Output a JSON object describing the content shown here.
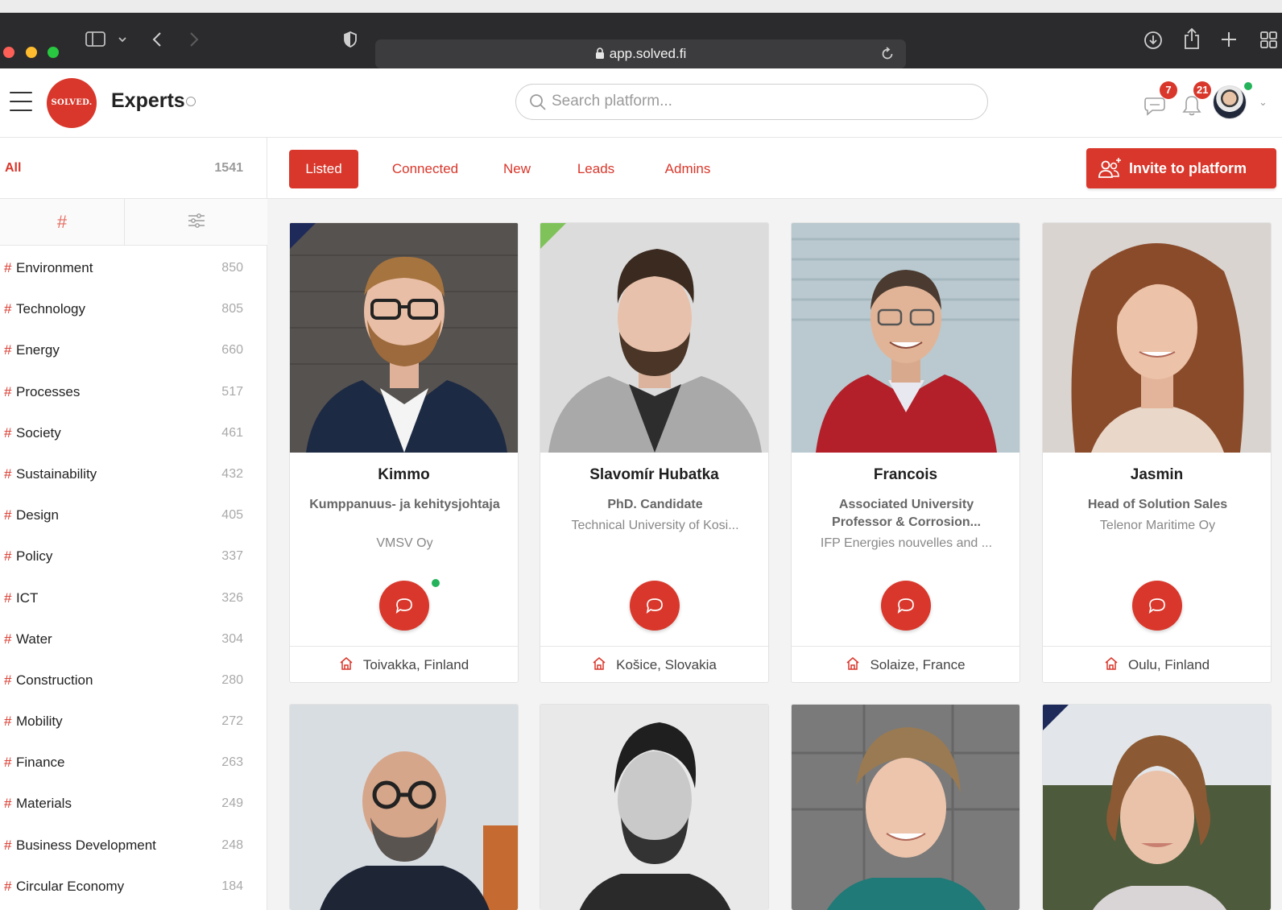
{
  "browser": {
    "url": "app.solved.fi"
  },
  "header": {
    "logo_text": "SOLVED.",
    "title": "Experts",
    "search_placeholder": "Search platform...",
    "messages_badge": "7",
    "notifications_badge": "21"
  },
  "sidebar": {
    "all_label": "All",
    "all_count": "1541",
    "hash_tab": "#",
    "categories": [
      {
        "name": "Environment",
        "count": "850"
      },
      {
        "name": "Technology",
        "count": "805"
      },
      {
        "name": "Energy",
        "count": "660"
      },
      {
        "name": "Processes",
        "count": "517"
      },
      {
        "name": "Society",
        "count": "461"
      },
      {
        "name": "Sustainability",
        "count": "432"
      },
      {
        "name": "Design",
        "count": "405"
      },
      {
        "name": "Policy",
        "count": "337"
      },
      {
        "name": "ICT",
        "count": "326"
      },
      {
        "name": "Water",
        "count": "304"
      },
      {
        "name": "Construction",
        "count": "280"
      },
      {
        "name": "Mobility",
        "count": "272"
      },
      {
        "name": "Finance",
        "count": "263"
      },
      {
        "name": "Materials",
        "count": "249"
      },
      {
        "name": "Business Development",
        "count": "248"
      },
      {
        "name": "Circular Economy",
        "count": "184"
      }
    ]
  },
  "tabs": {
    "listed": "Listed",
    "connected": "Connected",
    "new": "New",
    "leads": "Leads",
    "admins": "Admins",
    "invite": "Invite to platform"
  },
  "experts": [
    {
      "name": "Kimmo",
      "title": "Kumppanuus- ja kehitysjohtaja",
      "org": "VMSV Oy",
      "location": "Toivakka, Finland"
    },
    {
      "name": "Slavomír Hubatka",
      "title": "PhD. Candidate",
      "org": "Technical University of Kosi...",
      "location": "Košice, Slovakia"
    },
    {
      "name": "Francois",
      "title": "Associated University Professor & Corrosion...",
      "org": "IFP Energies nouvelles and ...",
      "location": "Solaize, France"
    },
    {
      "name": "Jasmin",
      "title": "Head of Solution Sales",
      "org": "Telenor Maritime Oy",
      "location": "Oulu, Finland"
    }
  ]
}
